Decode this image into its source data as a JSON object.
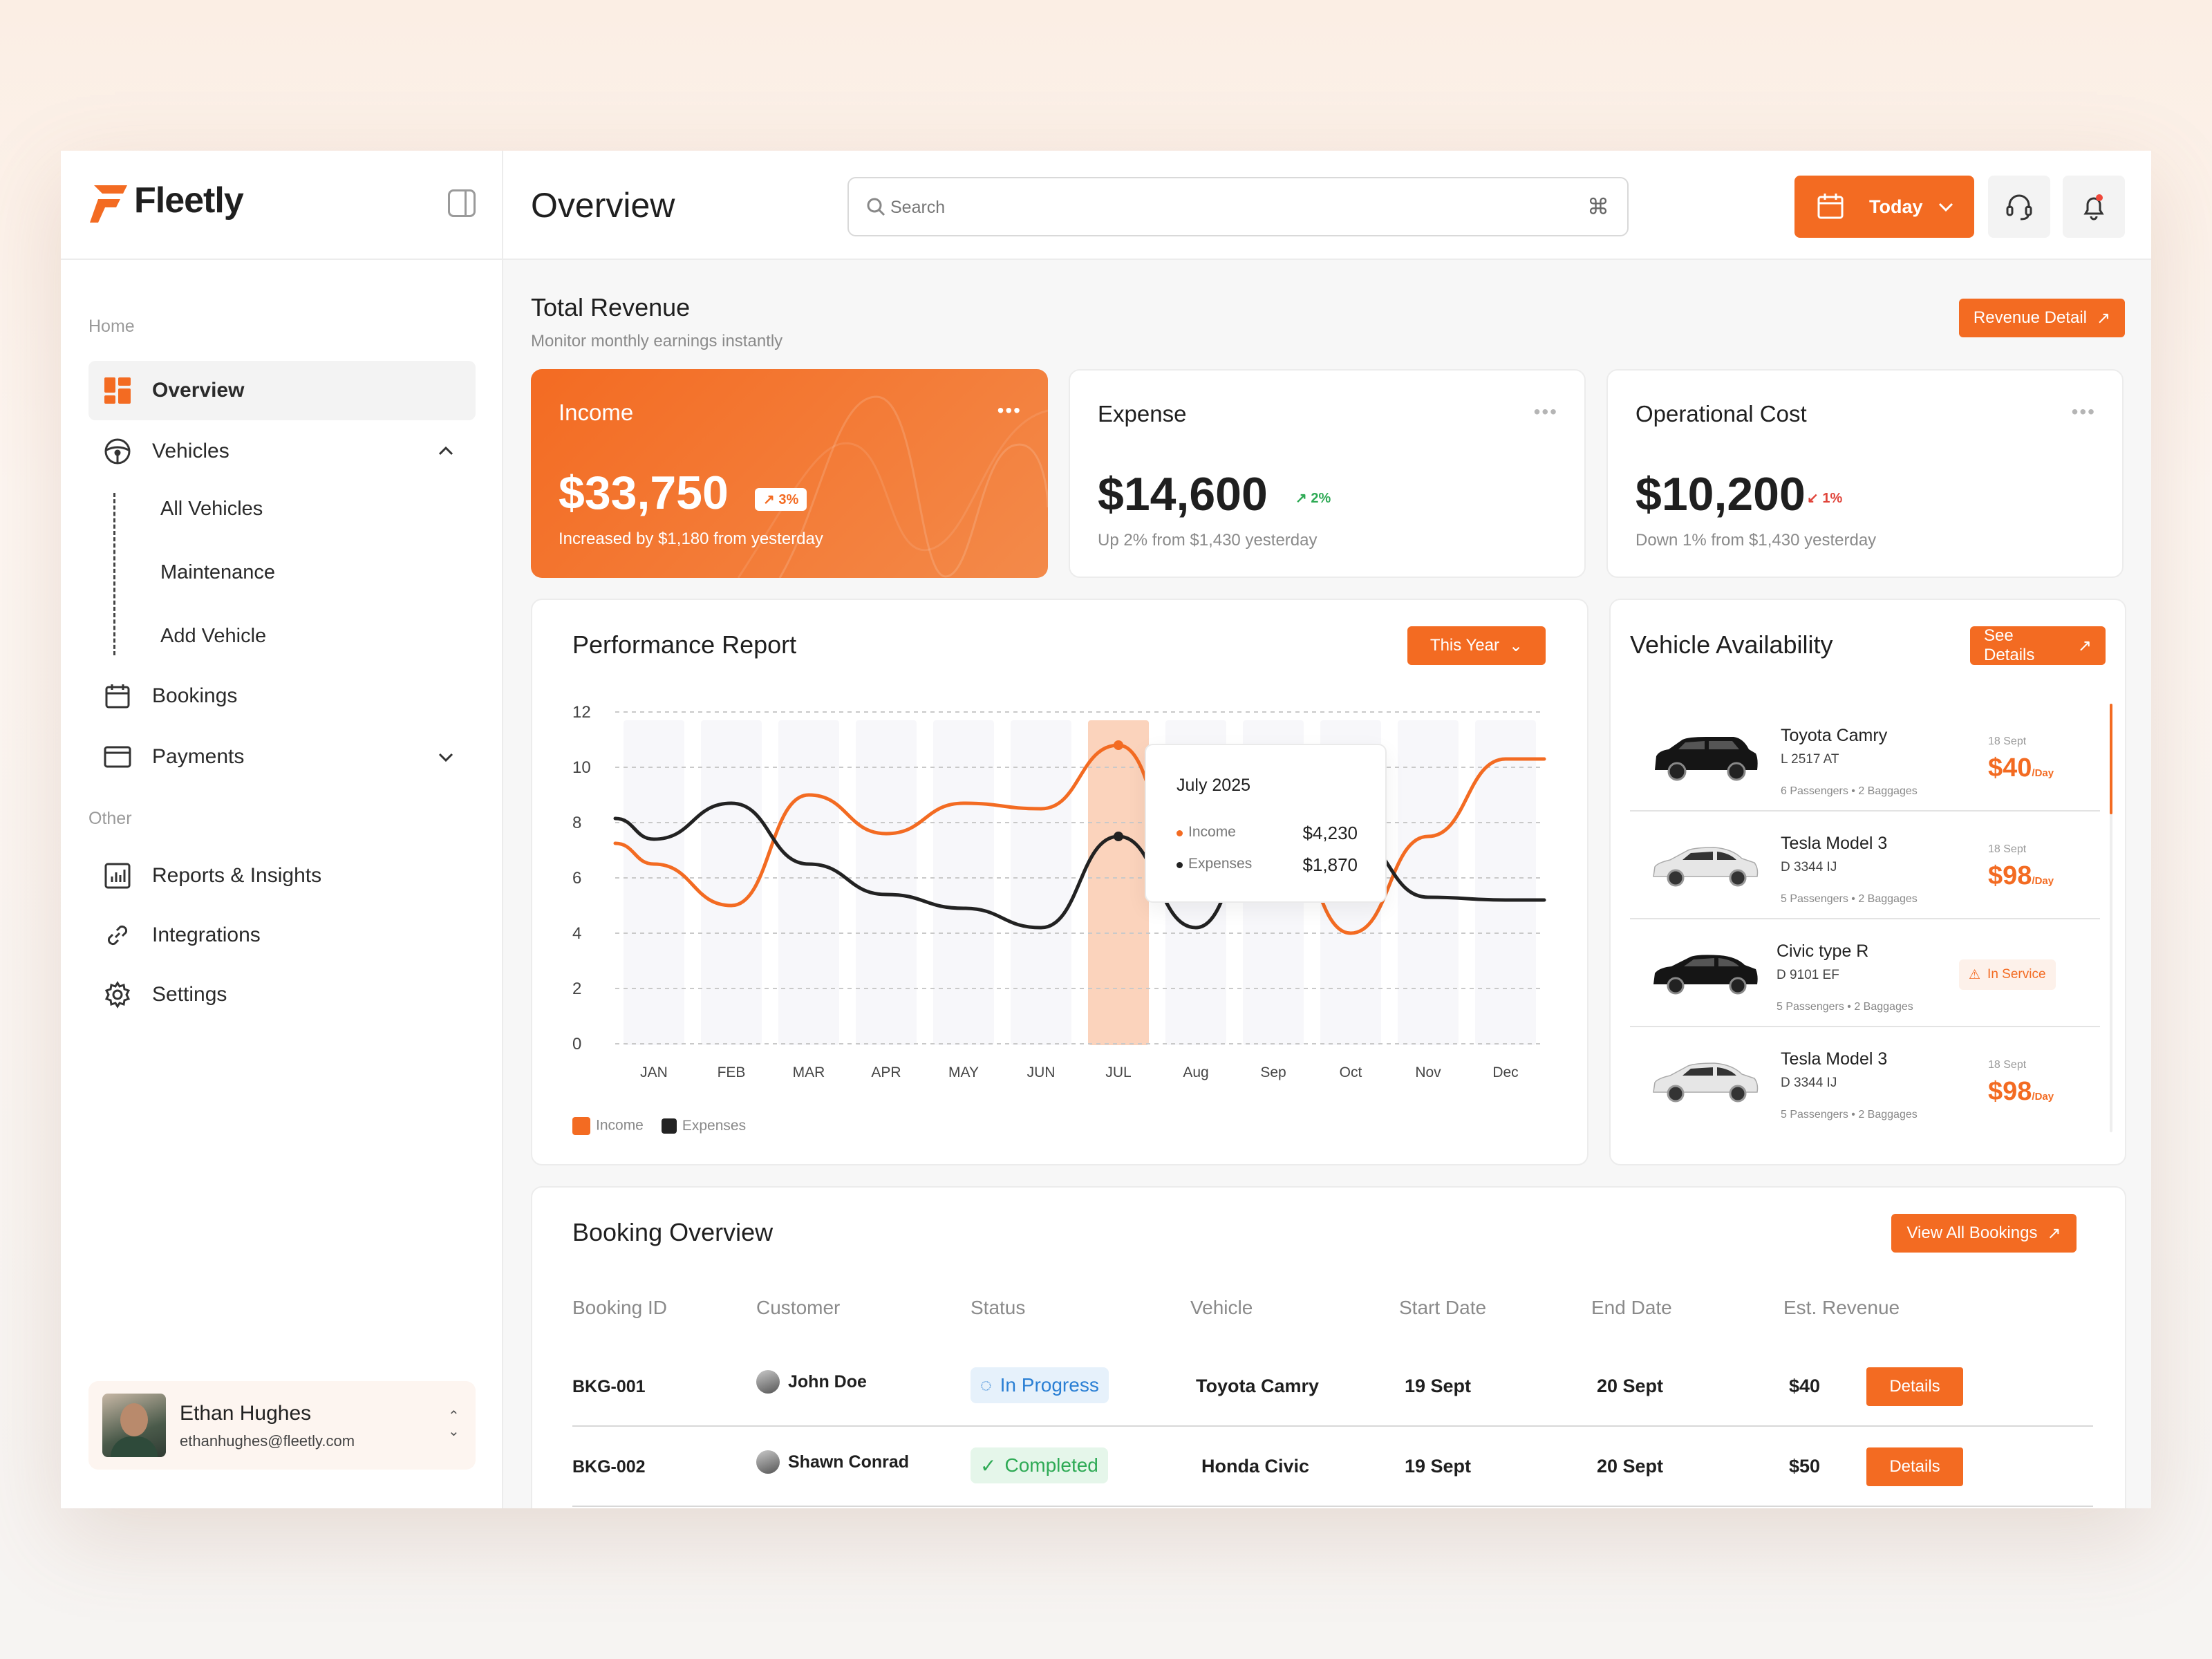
{
  "app": {
    "brand": "Fleetly",
    "brand_color": "#f36b22"
  },
  "sidebar": {
    "home_label": "Home",
    "other_label": "Other",
    "items": [
      {
        "label": "Overview",
        "icon": "grid-icon"
      },
      {
        "label": "Vehicles",
        "icon": "steering-wheel-icon"
      },
      {
        "label": "Bookings",
        "icon": "calendar-icon"
      },
      {
        "label": "Payments",
        "icon": "card-icon"
      },
      {
        "label": "Reports & Insights",
        "icon": "bar-chart-icon"
      },
      {
        "label": "Integrations",
        "icon": "link-icon"
      },
      {
        "label": "Settings",
        "icon": "gear-icon"
      }
    ],
    "vehicle_sub": [
      "All Vehicles",
      "Maintenance",
      "Add Vehicle"
    ],
    "user": {
      "name": "Ethan Hughes",
      "email": "ethanhughes@fleetly.com"
    }
  },
  "header": {
    "title": "Overview",
    "search_placeholder": "Search",
    "search_shortcut": "⌘",
    "date_filter": "Today"
  },
  "revenue": {
    "title": "Total Revenue",
    "subtitle": "Monitor monthly earnings instantly",
    "detail_button": "Revenue Detail",
    "cards": [
      {
        "title": "Income",
        "value": "$33,750",
        "change": "3%",
        "note": "Increased by $1,180 from yesterday"
      },
      {
        "title": "Expense",
        "value": "$14,600",
        "change": "2%",
        "note": "Up 2% from $1,430 yesterday"
      },
      {
        "title": "Operational Cost",
        "value": "$10,200",
        "change": "1%",
        "note": "Down 1% from $1,430 yesterday"
      }
    ]
  },
  "performance": {
    "title": "Performance Report",
    "filter": "This Year",
    "tooltip": {
      "title": "July 2025",
      "income_label": "Income",
      "income_value": "$4,230",
      "expense_label": "Expenses",
      "expense_value": "$1,870"
    },
    "legend": [
      "Income",
      "Expenses"
    ]
  },
  "chart_data": {
    "type": "line",
    "categories": [
      "JAN",
      "FEB",
      "MAR",
      "APR",
      "MAY",
      "JUN",
      "JUL",
      "Aug",
      "Sep",
      "Oct",
      "Nov",
      "Dec"
    ],
    "yticks": [
      "12",
      "10",
      "8",
      "6",
      "4",
      "2",
      "0"
    ],
    "ylim": [
      0,
      12
    ],
    "highlight": "JUL",
    "series": [
      {
        "name": "Income",
        "color": "#f36b22",
        "values": [
          6.5,
          5,
          9,
          7.6,
          8.7,
          8.5,
          10.8,
          5.5,
          8.5,
          4,
          7.5,
          10.3
        ]
      },
      {
        "name": "Expenses",
        "color": "#222222",
        "values": [
          7.4,
          8.7,
          6.5,
          5.4,
          4.9,
          4.2,
          7.5,
          4.2,
          9,
          7.5,
          5.3,
          5.2
        ]
      }
    ]
  },
  "availability": {
    "title": "Vehicle Availability",
    "button": "See Details",
    "vehicles": [
      {
        "name": "Toyota Camry",
        "plate": "L 2517 AT",
        "meta": "6 Passengers  •  2 Baggages",
        "date": "18 Sept",
        "price": "$40",
        "unit": "/Day",
        "car_color": "#151515"
      },
      {
        "name": "Tesla Model 3",
        "plate": "D 3344 IJ",
        "meta": "5 Passengers  •  2 Baggages",
        "date": "18 Sept",
        "price": "$98",
        "unit": "/Day",
        "car_color": "#e9e9e9"
      },
      {
        "name": "Civic type R",
        "plate": "D 9101 EF",
        "meta": "5 Passengers  •  2 Baggages",
        "status": "In Service",
        "car_color": "#151515"
      },
      {
        "name": "Tesla Model 3",
        "plate": "D 3344 IJ",
        "meta": "5 Passengers  •  2 Baggages",
        "date": "18 Sept",
        "price": "$98",
        "unit": "/Day",
        "car_color": "#e9e9e9"
      }
    ]
  },
  "bookings": {
    "title": "Booking Overview",
    "button": "View All Bookings",
    "columns": [
      "Booking ID",
      "Customer",
      "Status",
      "Vehicle",
      "Start Date",
      "End Date",
      "Est. Revenue"
    ],
    "rows": [
      {
        "id": "BKG-001",
        "customer": "John Doe",
        "status": "In Progress",
        "vehicle": "Toyota Camry",
        "start": "19 Sept",
        "end": "20 Sept",
        "revenue": "$40",
        "action": "Details"
      },
      {
        "id": "BKG-002",
        "customer": "Shawn Conrad",
        "status": "Completed",
        "vehicle": "Honda Civic",
        "start": "19 Sept",
        "end": "20 Sept",
        "revenue": "$50",
        "action": "Details"
      }
    ]
  }
}
